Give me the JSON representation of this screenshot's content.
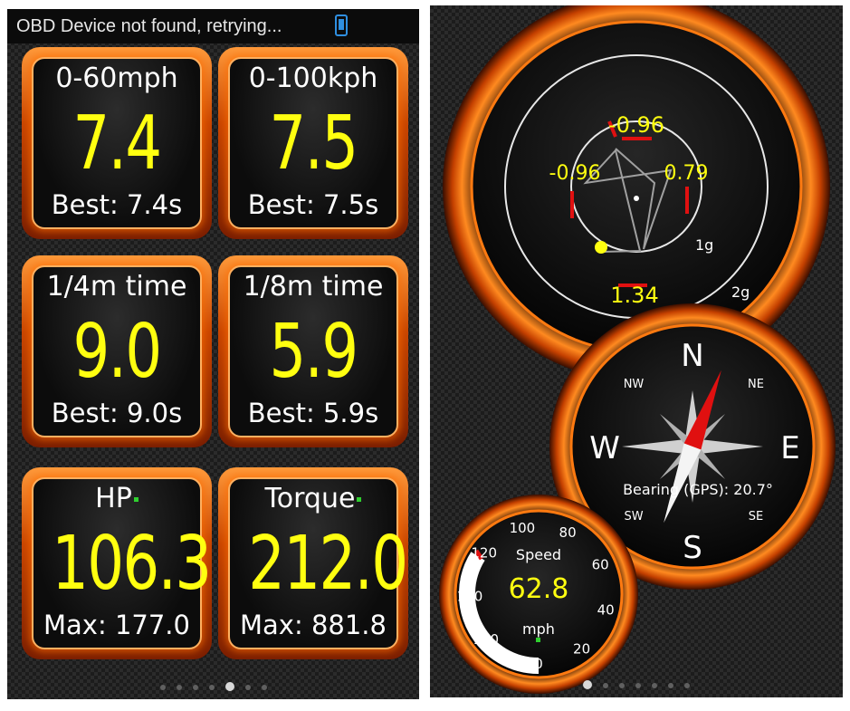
{
  "left_screen": {
    "status": {
      "message": "OBD Device not found, retrying...",
      "icon": "phone-icon"
    },
    "tiles": [
      {
        "label": "0-60mph",
        "value": "7.4",
        "sub": "Best: 7.4s"
      },
      {
        "label": "0-100kph",
        "value": "7.5",
        "sub": "Best: 7.5s"
      },
      {
        "label": "1/4m time",
        "value": "9.0",
        "sub": "Best: 9.0s"
      },
      {
        "label": "1/8m time",
        "value": "5.9",
        "sub": "Best: 5.9s"
      },
      {
        "label": "HP",
        "value": "106.3",
        "sub": "Max: 177.0"
      },
      {
        "label": "Torque",
        "value": "212.0",
        "sub": "Max: 881.8"
      }
    ],
    "pager": {
      "pages": 7,
      "active_index": 4
    }
  },
  "right_screen": {
    "gforce": {
      "top": "-0.96",
      "left": "-0.96",
      "right": "0.79",
      "bottom": "1.34",
      "ring_inner_label": "1g",
      "ring_outer_label": "2g"
    },
    "compass": {
      "n": "N",
      "s": "S",
      "e": "E",
      "w": "W",
      "nw": "NW",
      "ne": "NE",
      "sw": "SW",
      "se": "SE",
      "bearing_text": "Bearing (GPS): 20.7°",
      "bearing_deg": 20.7
    },
    "speedometer": {
      "title": "Speed",
      "value": "62.8",
      "unit": "mph",
      "ticks": [
        "0",
        "20",
        "40",
        "60",
        "80",
        "100",
        "120",
        "140",
        "160"
      ]
    },
    "pager": {
      "pages": 7,
      "active_index": 0
    }
  },
  "colors": {
    "accent_orange": "#ff6a00",
    "value_yellow": "#ffff10",
    "carbon_dark": "#1c1c1c",
    "needle_red": "#e01010",
    "status_dot_green": "#2fd02f"
  }
}
